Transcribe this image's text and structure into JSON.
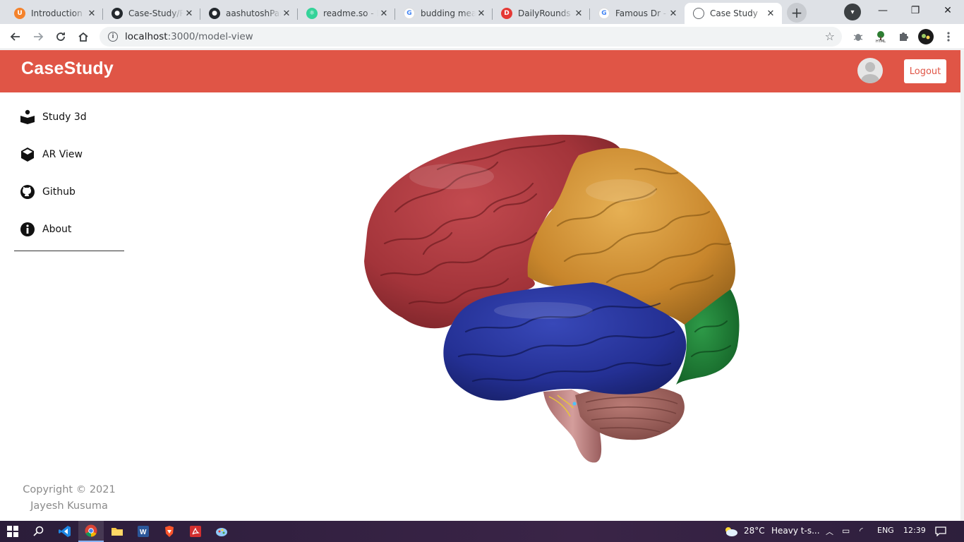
{
  "browser": {
    "tabs": [
      {
        "title": "Introduction t",
        "favicon_color": "#f4822b",
        "favicon_glyph": "U",
        "active": false
      },
      {
        "title": "Case-Study/R",
        "favicon_color": "#24292e",
        "favicon_glyph": "github-icon",
        "active": false
      },
      {
        "title": "aashutoshPan",
        "favicon_color": "#24292e",
        "favicon_glyph": "github-icon",
        "active": false
      },
      {
        "title": "readme.so - E",
        "favicon_color": "#34d399",
        "favicon_glyph": "react-icon",
        "active": false
      },
      {
        "title": "budding mea",
        "favicon_color": "#4285f4",
        "favicon_glyph": "google-icon",
        "active": false
      },
      {
        "title": "DailyRounds",
        "favicon_color": "#e53935",
        "favicon_glyph": "D",
        "active": false
      },
      {
        "title": "Famous Dr - C",
        "favicon_color": "#4285f4",
        "favicon_glyph": "google-icon",
        "active": false
      },
      {
        "title": "Case Study",
        "favicon_color": "#5f6368",
        "favicon_glyph": "globe-icon",
        "active": true
      }
    ],
    "url_host": "localhost",
    "url_path": ":3000/model-view"
  },
  "header": {
    "brand": "CaseStudy",
    "logout_label": "Logout"
  },
  "sidebar": {
    "items": [
      {
        "label": "Study 3d",
        "icon": "reader-icon"
      },
      {
        "label": "AR View",
        "icon": "cube-icon"
      },
      {
        "label": "Github",
        "icon": "github-icon"
      },
      {
        "label": "About",
        "icon": "info-icon"
      }
    ],
    "copyright_line1": "Copyright © 2021",
    "copyright_line2": "Jayesh Kusuma"
  },
  "model": {
    "regions": [
      {
        "name": "frontal-lobe",
        "color": "#a8363b"
      },
      {
        "name": "parietal-lobe",
        "color": "#c98a2e"
      },
      {
        "name": "temporal-lobe",
        "color": "#27359c"
      },
      {
        "name": "occipital-lobe",
        "color": "#1f7a34"
      },
      {
        "name": "cerebellum",
        "color": "#a06864"
      },
      {
        "name": "brain-stem",
        "color": "#c98e8c"
      }
    ]
  },
  "taskbar": {
    "weather": "28°C",
    "weather_desc": "Heavy t-s...",
    "lang": "ENG",
    "time": "12:39"
  },
  "colors": {
    "accent": "#e05546",
    "tabstrip": "#dee1e6"
  }
}
